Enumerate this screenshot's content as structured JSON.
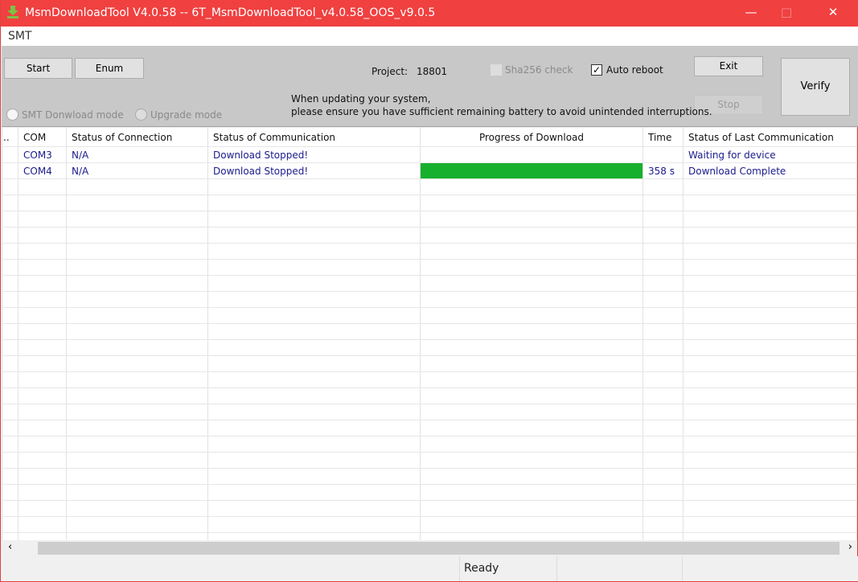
{
  "window": {
    "title": "MsmDownloadTool V4.0.58 -- 6T_MsmDownloadTool_v4.0.58_OOS_v9.0.5",
    "accent": "#f04040"
  },
  "menu": {
    "tab": "SMT"
  },
  "toolbar": {
    "start": "Start",
    "enum": "Enum",
    "exit": "Exit",
    "stop": "Stop",
    "verify": "Verify",
    "project_label": "Project:",
    "project_value": "18801",
    "sha256": {
      "label": "Sha256 check",
      "checked": true,
      "disabled": true
    },
    "auto_reboot": {
      "label": "Auto reboot",
      "checked": true
    },
    "mode_smt": "SMT Donwload mode",
    "mode_upgrade": "Upgrade mode",
    "notice_line1": "When updating your system,",
    "notice_line2": "please ensure you have sufficient remaining battery to avoid unintended interruptions."
  },
  "table": {
    "columns": [
      "..",
      "COM",
      "Status of Connection",
      "Status of Communication",
      "Progress of Download",
      "Time",
      "Status of Last Communication"
    ],
    "rows": [
      {
        "com": "COM3",
        "connection": "N/A",
        "communication": "Download Stopped!",
        "progress": 0,
        "time": "",
        "last": "Waiting for device"
      },
      {
        "com": "COM4",
        "connection": "N/A",
        "communication": "Download Stopped!",
        "progress": 100,
        "time": "358 s",
        "last": "Download Complete"
      }
    ],
    "progress_color": "#17b02e"
  },
  "status": {
    "text": "Ready"
  }
}
